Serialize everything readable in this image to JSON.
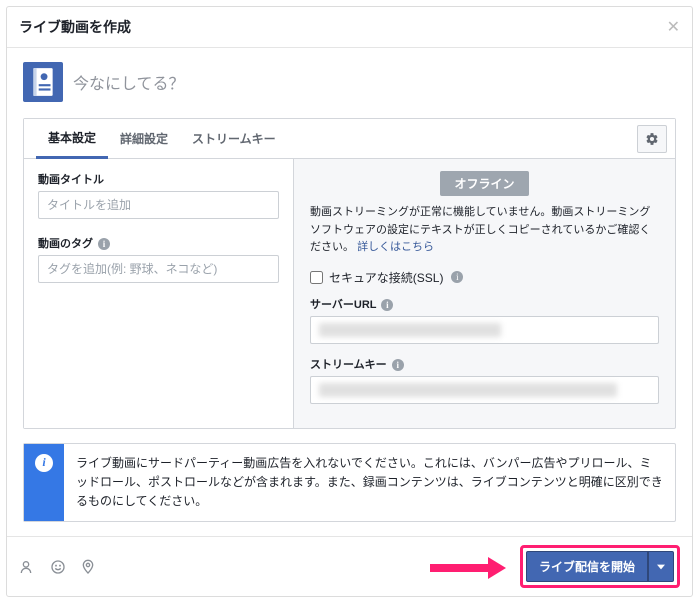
{
  "header": {
    "title": "ライブ動画を作成"
  },
  "composer": {
    "placeholder": "今なにしてる？"
  },
  "tabs": {
    "basic": "基本設定",
    "advanced": "詳細設定",
    "streamkey": "ストリームキー"
  },
  "left": {
    "title_label": "動画タイトル",
    "title_placeholder": "タイトルを追加",
    "tags_label": "動画のタグ",
    "tags_placeholder": "タグを追加(例: 野球、ネコなど)"
  },
  "right": {
    "offline": "オフライン",
    "desc": "動画ストリーミングが正常に機能していません。動画ストリーミングソフトウェアの設定にテキストが正しくコピーされているかご確認ください。",
    "desc_link": "詳しくはこちら",
    "ssl_label": "セキュアな接続(SSL)",
    "server_label": "サーバーURL",
    "key_label": "ストリームキー"
  },
  "notice": {
    "text": "ライブ動画にサードパーティー動画広告を入れないでください。これには、バンパー広告やプリロール、ミッドロール、ポストロールなどが含まれます。また、録画コンテンツは、ライブコンテンツと明確に区別できるものにしてください。"
  },
  "footer": {
    "start_label": "ライブ配信を開始"
  }
}
